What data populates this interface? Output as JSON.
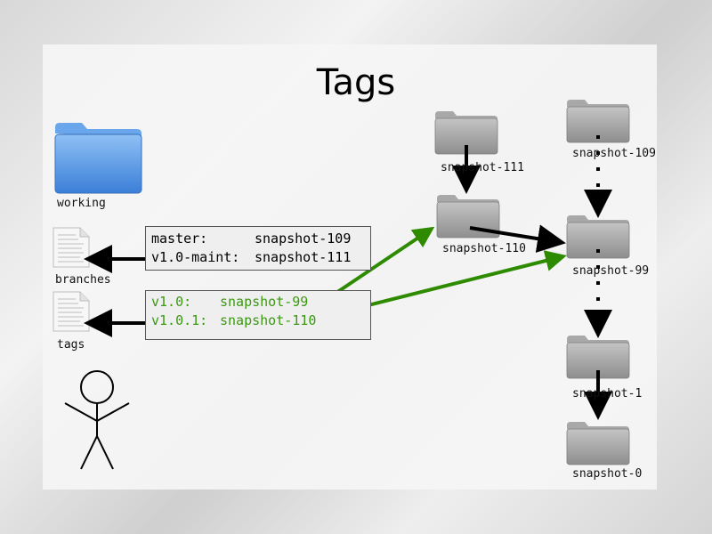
{
  "slide": {
    "title": "Tags"
  },
  "left_icons": {
    "working": "working",
    "branches": "branches",
    "tags": "tags"
  },
  "branches_box": {
    "rows": [
      {
        "name": "master:",
        "target": "snapshot-109"
      },
      {
        "name": "v1.0-maint:",
        "target": "snapshot-111"
      }
    ]
  },
  "tags_box": {
    "rows": [
      {
        "name": "v1.0:",
        "target": "snapshot-99"
      },
      {
        "name": "v1.0.1:",
        "target": "snapshot-110"
      }
    ]
  },
  "snapshots": {
    "s111": "snapshot-111",
    "s110": "snapshot-110",
    "s109": "snapshot-109",
    "s99": "snapshot-99",
    "s1": "snapshot-1",
    "s0": "snapshot-0"
  },
  "colors": {
    "tag_green": "#2e8b00",
    "tag_text": "#3a9a10",
    "folder_blue": "#4d8fde",
    "folder_gray": "#9a9a9a"
  }
}
